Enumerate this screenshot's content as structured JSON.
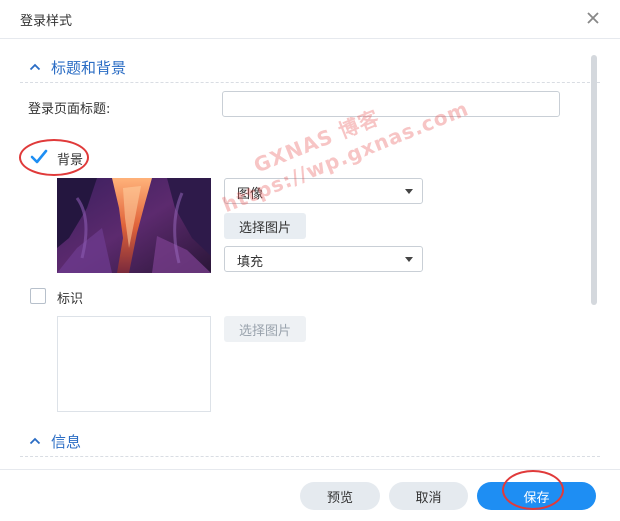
{
  "dialog": {
    "title": "登录样式",
    "close_icon": "close-icon"
  },
  "sections": {
    "title_background": {
      "label": "标题和背景",
      "icon": "chevron-up-icon"
    },
    "info": {
      "label": "信息",
      "icon": "chevron-up-icon"
    }
  },
  "login_title": {
    "label": "登录页面标题:",
    "value": ""
  },
  "background": {
    "checkbox_checked": true,
    "label": "背景",
    "type_select": {
      "value": "图像"
    },
    "choose_image_label": "选择图片",
    "fill_select": {
      "value": "填充"
    }
  },
  "logo": {
    "checkbox_checked": false,
    "label": "标识",
    "choose_image_label": "选择图片"
  },
  "footer": {
    "preview_label": "预览",
    "cancel_label": "取消",
    "save_label": "保存"
  },
  "watermark": {
    "line1": "GXNAS 博客",
    "line2": "https://wp.gxnas.com"
  },
  "colors": {
    "accent": "#1e8ef3",
    "section_title": "#2a6cc4",
    "annotation": "#e03a3a"
  }
}
